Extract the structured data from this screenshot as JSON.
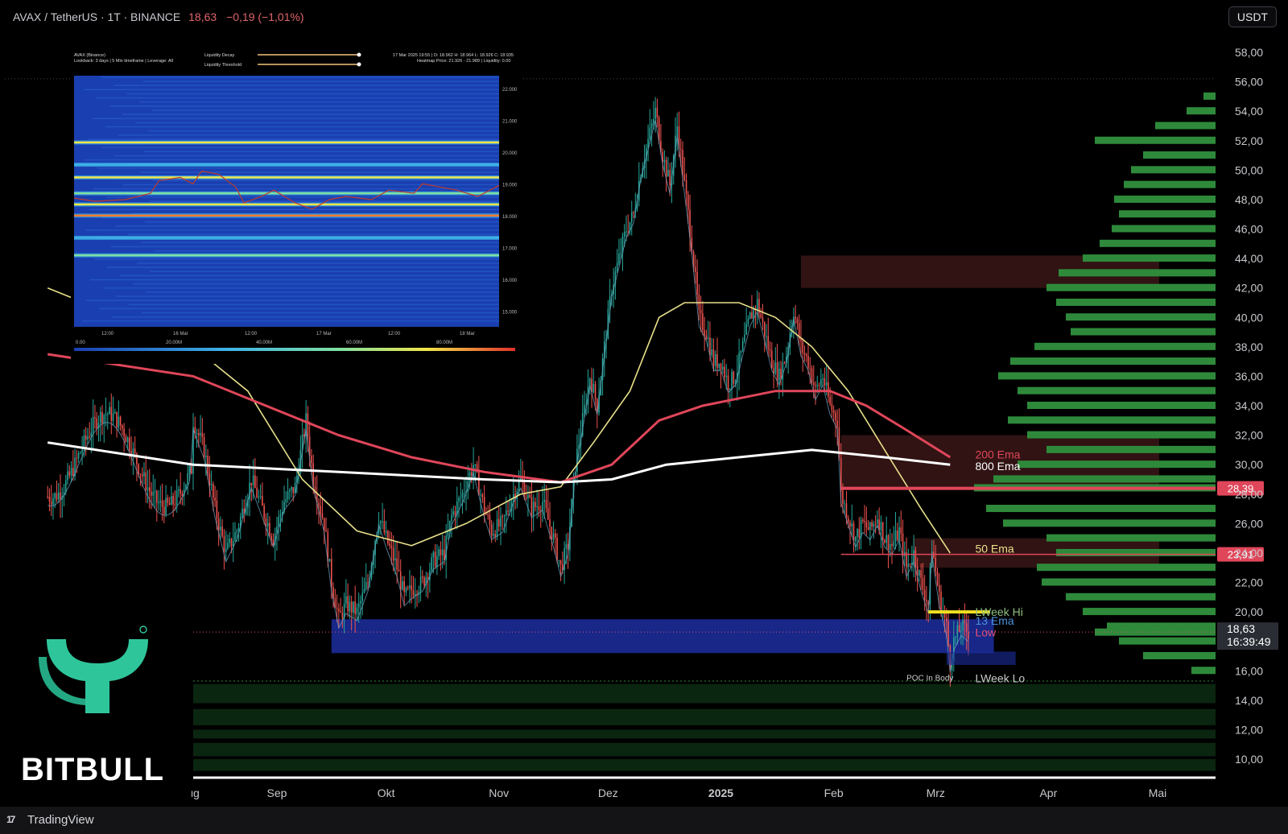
{
  "header": {
    "symbol_line": "AVAX / TetherUS · 1T · BINANCE",
    "price": "18,63",
    "change": "−0,19 (−1,01%)"
  },
  "currency_button": "USDT",
  "brand": {
    "name": "BITBULL",
    "reg": "®"
  },
  "footer": {
    "platform": "TradingView"
  },
  "chart_data": {
    "type": "candlestick",
    "y_axis": {
      "ticks": [
        "58,00",
        "56,00",
        "54,00",
        "52,00",
        "50,00",
        "48,00",
        "46,00",
        "44,00",
        "42,00",
        "40,00",
        "38,00",
        "36,00",
        "34,00",
        "32,00",
        "30,00",
        "28,00",
        "26,00",
        "24,00",
        "22,00",
        "20,00",
        "18,00",
        "16,00",
        "14,00",
        "12,00",
        "10,00"
      ],
      "tick_values": [
        58,
        56,
        54,
        52,
        50,
        48,
        46,
        44,
        42,
        40,
        38,
        36,
        34,
        32,
        30,
        28,
        26,
        24,
        22,
        20,
        18,
        16,
        14,
        12,
        10
      ],
      "range": [
        9,
        59
      ]
    },
    "x_axis": {
      "ticks": [
        "ug",
        "Sep",
        "Okt",
        "Nov",
        "Dez",
        "2025",
        "Feb",
        "Mrz",
        "Apr",
        "Mai"
      ],
      "tick_days": [
        0,
        23,
        53,
        84,
        114,
        145,
        176,
        204,
        235,
        265
      ],
      "bold_tick": "2025"
    },
    "price_path": [
      [
        0,
        33
      ],
      [
        3,
        31
      ],
      [
        6,
        27
      ],
      [
        9,
        24
      ],
      [
        12,
        25.5
      ],
      [
        16,
        29
      ],
      [
        19,
        27
      ],
      [
        22,
        25
      ],
      [
        25,
        27.5
      ],
      [
        28,
        28.5
      ],
      [
        31,
        33
      ],
      [
        33,
        29
      ],
      [
        36,
        26
      ],
      [
        38,
        22
      ],
      [
        40,
        19.5
      ],
      [
        42,
        20.5
      ],
      [
        45,
        20
      ],
      [
        48,
        22
      ],
      [
        51,
        26.5
      ],
      [
        53,
        25
      ],
      [
        56,
        23
      ],
      [
        58,
        21
      ],
      [
        60,
        21.5
      ],
      [
        63,
        22
      ],
      [
        66,
        23.5
      ],
      [
        69,
        24
      ],
      [
        71,
        26.5
      ],
      [
        74,
        28
      ],
      [
        77,
        30
      ],
      [
        80,
        27
      ],
      [
        82,
        25.5
      ],
      [
        85,
        26
      ],
      [
        88,
        28
      ],
      [
        90,
        29
      ],
      [
        93,
        27
      ],
      [
        96,
        27.5
      ],
      [
        99,
        25
      ],
      [
        101,
        23
      ],
      [
        103,
        24.5
      ],
      [
        105,
        30
      ],
      [
        107,
        33
      ],
      [
        109,
        36
      ],
      [
        111,
        34
      ],
      [
        113,
        38
      ],
      [
        115,
        42
      ],
      [
        117,
        44
      ],
      [
        119,
        46
      ],
      [
        121,
        47
      ],
      [
        123,
        50
      ],
      [
        125,
        52
      ],
      [
        127,
        54
      ],
      [
        129,
        51
      ],
      [
        131,
        49
      ],
      [
        133,
        53
      ],
      [
        135,
        49
      ],
      [
        137,
        45
      ],
      [
        139,
        40
      ],
      [
        141,
        39
      ],
      [
        143,
        37
      ],
      [
        145,
        37
      ],
      [
        147,
        35.5
      ],
      [
        149,
        36
      ],
      [
        151,
        38
      ],
      [
        153,
        40
      ],
      [
        155,
        41
      ],
      [
        157,
        39
      ],
      [
        159,
        37
      ],
      [
        161,
        36
      ],
      [
        163,
        37.5
      ],
      [
        165,
        40.5
      ],
      [
        167,
        38
      ],
      [
        169,
        37
      ],
      [
        171,
        35
      ],
      [
        173,
        36
      ],
      [
        175,
        34
      ],
      [
        177,
        33
      ],
      [
        178,
        28
      ],
      [
        180,
        26.5
      ],
      [
        182,
        25
      ],
      [
        184,
        26
      ],
      [
        186,
        25.5
      ],
      [
        188,
        26.5
      ],
      [
        190,
        25
      ],
      [
        192,
        24.5
      ],
      [
        194,
        25.5
      ],
      [
        196,
        23
      ],
      [
        198,
        24
      ],
      [
        200,
        22
      ],
      [
        202,
        20.5
      ],
      [
        203,
        24.5
      ],
      [
        205,
        21
      ],
      [
        207,
        19
      ],
      [
        208,
        16.5
      ],
      [
        209,
        18
      ],
      [
        211,
        19
      ],
      [
        213,
        18.6
      ]
    ],
    "emas": [
      {
        "name": "50 Ema",
        "color": "#e8e08a",
        "values": [
          [
            0,
            38
          ],
          [
            15,
            35
          ],
          [
            30,
            29
          ],
          [
            45,
            25.5
          ],
          [
            60,
            24.5
          ],
          [
            75,
            26
          ],
          [
            90,
            28
          ],
          [
            101,
            28.5
          ],
          [
            110,
            31.5
          ],
          [
            120,
            35
          ],
          [
            128,
            40
          ],
          [
            135,
            41
          ],
          [
            150,
            41
          ],
          [
            160,
            40
          ],
          [
            170,
            38
          ],
          [
            180,
            35
          ],
          [
            190,
            31
          ],
          [
            200,
            27
          ],
          [
            208,
            24
          ]
        ]
      },
      {
        "name": "200 Ema",
        "color": "#e0465a",
        "values": [
          [
            0,
            36
          ],
          [
            20,
            34
          ],
          [
            40,
            32
          ],
          [
            60,
            30.5
          ],
          [
            80,
            29.5
          ],
          [
            101,
            28.8
          ],
          [
            115,
            30
          ],
          [
            128,
            33
          ],
          [
            140,
            34
          ],
          [
            160,
            35
          ],
          [
            175,
            35
          ],
          [
            185,
            34
          ],
          [
            195,
            32.5
          ],
          [
            208,
            30.5
          ]
        ]
      },
      {
        "name": "800 Ema",
        "color": "#ffffff",
        "values": [
          [
            0,
            30
          ],
          [
            40,
            29.5
          ],
          [
            80,
            29
          ],
          [
            101,
            28.8
          ],
          [
            115,
            29
          ],
          [
            130,
            30
          ],
          [
            150,
            30.5
          ],
          [
            170,
            31
          ],
          [
            190,
            30.5
          ],
          [
            208,
            30
          ]
        ]
      }
    ],
    "horizontal_lines": [
      {
        "label": "28,39",
        "value": 28.39,
        "color": "#e0465a",
        "x_start": 178
      },
      {
        "label": "23,91",
        "value": 23.91,
        "color": "#e0465a",
        "x_start": 178
      }
    ],
    "zones": [
      {
        "low": 42,
        "high": 44.2,
        "color": "#3a1616",
        "x_start": 167
      },
      {
        "low": 28.5,
        "high": 32,
        "color": "#3a1616",
        "x_start": 178
      },
      {
        "low": 23,
        "high": 25,
        "color": "#3a1616",
        "x_start": 198
      },
      {
        "low": 17.2,
        "high": 19.5,
        "color": "#1c2ea0",
        "x_start": 38,
        "x_end": 220
      }
    ],
    "annotations": [
      {
        "text": "200 Ema",
        "value": 30.7,
        "color": "#e0465a"
      },
      {
        "text": "800 Ema",
        "value": 29.9,
        "color": "#ffffff"
      },
      {
        "text": "50 Ema",
        "value": 24.3,
        "color": "#e8e08a"
      },
      {
        "text": "LWeek Hi",
        "value": 20.0,
        "color": "#8fbf7f"
      },
      {
        "text": "13 Ema",
        "value": 19.4,
        "color": "#4a90d9"
      },
      {
        "text": "Low",
        "value": 18.6,
        "color": "#e04f7a"
      },
      {
        "text": "LWeek Lo",
        "value": 15.5,
        "color": "#c9c9c9"
      },
      {
        "text": "POC In Body",
        "value": 15.6,
        "color": "#c9c9c9"
      }
    ],
    "current_price": {
      "label": "18,63",
      "countdown": "16:39:49",
      "value": 18.63
    },
    "volume_profile": {
      "color": "#2e8a3a",
      "levels": [
        [
          55,
          0.05
        ],
        [
          54,
          0.12
        ],
        [
          53,
          0.25
        ],
        [
          52,
          0.5
        ],
        [
          51,
          0.3
        ],
        [
          50,
          0.35
        ],
        [
          49,
          0.38
        ],
        [
          48,
          0.42
        ],
        [
          47,
          0.4
        ],
        [
          46,
          0.43
        ],
        [
          45,
          0.48
        ],
        [
          44,
          0.55
        ],
        [
          43,
          0.65
        ],
        [
          42,
          0.7
        ],
        [
          41,
          0.66
        ],
        [
          40,
          0.62
        ],
        [
          39,
          0.6
        ],
        [
          38,
          0.75
        ],
        [
          37,
          0.85
        ],
        [
          36,
          0.9
        ],
        [
          35,
          0.82
        ],
        [
          34,
          0.78
        ],
        [
          33,
          0.86
        ],
        [
          32,
          0.78
        ],
        [
          31,
          0.7
        ],
        [
          30,
          0.82
        ],
        [
          29,
          0.92
        ],
        [
          28.4,
          1.0
        ],
        [
          27,
          0.95
        ],
        [
          26,
          0.88
        ],
        [
          25,
          0.7
        ],
        [
          24,
          0.66
        ],
        [
          23,
          0.74
        ],
        [
          22,
          0.72
        ],
        [
          21,
          0.62
        ],
        [
          20,
          0.55
        ],
        [
          19,
          0.45
        ],
        [
          18.6,
          0.5
        ],
        [
          18,
          0.4
        ],
        [
          17,
          0.3
        ],
        [
          16,
          0.1
        ]
      ]
    }
  },
  "inset_heatmap": {
    "header_left_1": "AVAX (Binance)",
    "header_left_2": "Lookback: 3 days | 5 Min timeframe | Leverage: All",
    "control_1": "Liquidity Decay",
    "control_2": "Liquidity Threshold",
    "header_right_1": "17 Mar 2025 19:55 | O: 18.962 H: 18.964 L: 18.926 C: 18.935",
    "header_right_2": "Heatmap Price: 21.926 - 21.989 | Liquidity: 0.00",
    "y_ticks": [
      "22.000",
      "21.000",
      "20.000",
      "19.000",
      "18.000",
      "17.000",
      "16.000",
      "15.000"
    ],
    "x_ticks": [
      "12:00",
      "16 Mar",
      "12:00",
      "17 Mar",
      "12:00",
      "18 Mar"
    ],
    "scale_ticks": [
      "0.00",
      "20.00M",
      "40.00M",
      "60.00M",
      "80.00M"
    ],
    "bands": [
      {
        "price": 20.3,
        "intensity": 0.85
      },
      {
        "price": 19.2,
        "intensity": 0.9
      },
      {
        "price": 18.7,
        "intensity": 0.6
      },
      {
        "price": 18.35,
        "intensity": 0.95
      },
      {
        "price": 18.0,
        "intensity": 1.0
      },
      {
        "price": 16.75,
        "intensity": 0.7
      },
      {
        "price": 19.6,
        "intensity": 0.4
      },
      {
        "price": 17.3,
        "intensity": 0.3
      }
    ],
    "price_path": [
      [
        0,
        18.55
      ],
      [
        0.05,
        18.45
      ],
      [
        0.12,
        18.5
      ],
      [
        0.18,
        18.7
      ],
      [
        0.2,
        19.1
      ],
      [
        0.25,
        19.2
      ],
      [
        0.28,
        19.0
      ],
      [
        0.3,
        19.4
      ],
      [
        0.34,
        19.3
      ],
      [
        0.38,
        18.9
      ],
      [
        0.4,
        18.4
      ],
      [
        0.44,
        18.6
      ],
      [
        0.47,
        18.8
      ],
      [
        0.52,
        18.4
      ],
      [
        0.56,
        18.2
      ],
      [
        0.6,
        18.5
      ],
      [
        0.64,
        18.6
      ],
      [
        0.7,
        18.5
      ],
      [
        0.74,
        18.8
      ],
      [
        0.8,
        18.7
      ],
      [
        0.82,
        19.0
      ],
      [
        0.86,
        18.9
      ],
      [
        0.9,
        18.8
      ],
      [
        0.95,
        18.6
      ],
      [
        1,
        18.95
      ]
    ]
  }
}
